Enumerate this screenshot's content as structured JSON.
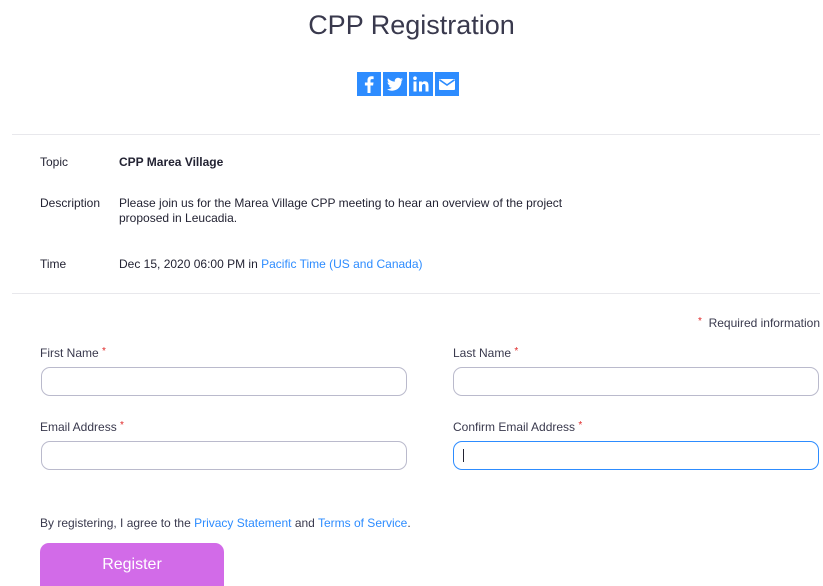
{
  "page": {
    "title": "CPP Registration"
  },
  "share": {
    "facebook_icon": "facebook-icon",
    "twitter_icon": "twitter-icon",
    "linkedin_icon": "linkedin-icon",
    "email_icon": "email-icon",
    "brand_color": "#2d8cff"
  },
  "meeting": {
    "topic_label": "Topic",
    "topic_value": "CPP Marea Village",
    "description_label": "Description",
    "description_value": "Please join us for the Marea Village CPP meeting to hear an overview of the project proposed in Leucadia.",
    "time_label": "Time",
    "time_value": "Dec 15, 2020 06:00 PM in",
    "time_zone_link": "Pacific Time (US and Canada)"
  },
  "form": {
    "required_star": "*",
    "required_note": "Required information",
    "first_name_label": "First Name",
    "first_name_value": "",
    "last_name_label": "Last Name",
    "last_name_value": "",
    "email_label": "Email Address",
    "email_value": "",
    "confirm_email_label": "Confirm Email Address",
    "confirm_email_value": ""
  },
  "agreement": {
    "prefix": "By registering, I agree to the",
    "privacy_link": "Privacy Statement",
    "and_text": "and",
    "terms_link": "Terms of Service",
    "suffix": "."
  },
  "actions": {
    "register_label": "Register",
    "register_color": "#d26be8"
  }
}
